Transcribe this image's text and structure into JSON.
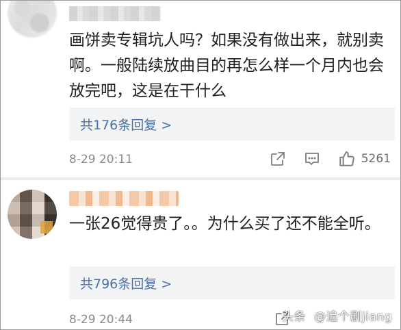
{
  "comments": [
    {
      "text": "画饼卖专辑坑人吗？如果没有做出来，就别卖啊。一般陆续放曲目的再怎么样一个月内也会放完吧，这是在干什么",
      "replies_label": "共176条回复 >",
      "timestamp": "8-29 20:11",
      "likes": "5261",
      "icons": [
        "share-icon",
        "comment-icon",
        "like-icon"
      ]
    },
    {
      "text": "一张26觉得贵了。。为什么买了还不能全听。",
      "replies_label": "共796条回复 >",
      "timestamp": "8-29 20:44",
      "icons": [
        "share-icon"
      ]
    }
  ],
  "watermark": {
    "brand": "头条",
    "handle": "@追个剧jiang"
  },
  "colors": {
    "link": "#4a6fa5",
    "reply_bg": "#f2f3f5",
    "meta": "#8a8a8a",
    "text": "#1e1e1e"
  }
}
